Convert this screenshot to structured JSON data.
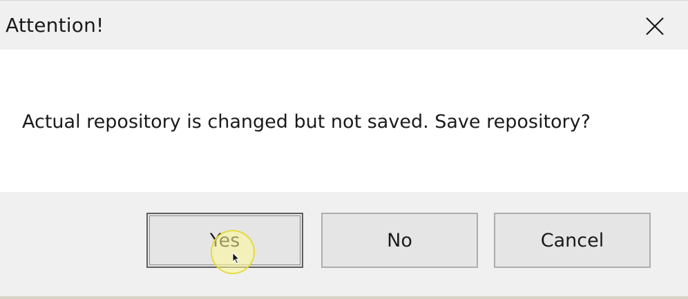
{
  "dialog": {
    "title": "Attention!",
    "message": "Actual repository is changed but not saved. Save repository?",
    "close_icon": "close-icon"
  },
  "buttons": {
    "yes_label": "Yes",
    "no_label": "No",
    "cancel_label": "Cancel",
    "default": "yes"
  },
  "colors": {
    "titlebar_bg": "#f0f0f0",
    "content_bg": "#ffffff",
    "footer_bg": "#f0f0f0",
    "button_bg": "#e5e5e5",
    "button_border": "#adadad",
    "cursor_highlight": "#fff796"
  },
  "cursor": {
    "icon": "mouse-pointer-icon",
    "hover_target": "yes-button"
  }
}
